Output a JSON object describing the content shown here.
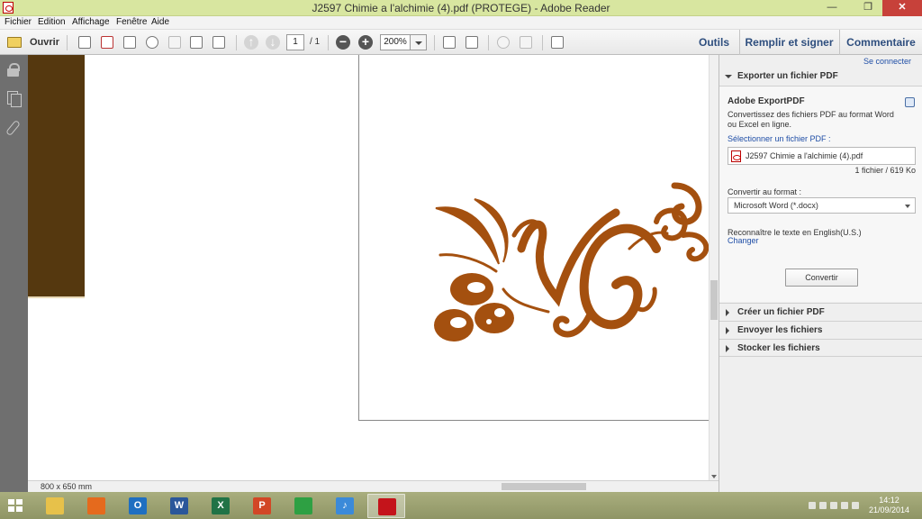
{
  "window": {
    "title": "J2597 Chimie a l'alchimie (4).pdf (PROTEGE) - Adobe Reader",
    "minimize": "—",
    "restore": "❐",
    "close": "✕"
  },
  "menu": [
    "Fichier",
    "Edition",
    "Affichage",
    "Fenêtre",
    "Aide"
  ],
  "toolbar": {
    "open_label": "Ouvrir",
    "page_current": "1",
    "page_total": "/ 1",
    "zoom_value": "200%",
    "tabs": [
      "Outils",
      "Remplir et signer",
      "Commentaire"
    ]
  },
  "status": {
    "page_size": "800 x 650 mm"
  },
  "pane": {
    "connect": "Se connecter",
    "export_header": "Exporter un fichier PDF",
    "export_title": "Adobe ExportPDF",
    "export_desc": "Convertissez des fichiers PDF au format Word ou Excel en ligne.",
    "select_label": "Sélectionner un fichier PDF :",
    "file_name": "J2597 Chimie a l'alchimie (4).pdf",
    "file_count": "1 fichier / 619 Ko",
    "convert_label": "Convertir au format :",
    "format_value": "Microsoft Word (*.docx)",
    "ocr_text": "Reconnaître le texte en English(U.S.)",
    "change_link": "Changer",
    "convert_button": "Convertir",
    "sections": [
      "Créer un fichier PDF",
      "Envoyer les fichiers",
      "Stocker les fichiers"
    ]
  },
  "taskbar": {
    "time": "14:12",
    "date": "21/09/2014",
    "apps": [
      {
        "name": "file-explorer",
        "glyph": "",
        "color": "#e7c14a"
      },
      {
        "name": "firefox",
        "glyph": "",
        "color": "#e56a1d"
      },
      {
        "name": "outlook",
        "glyph": "O",
        "color": "#1f6fc1"
      },
      {
        "name": "word",
        "glyph": "W",
        "color": "#2b579a"
      },
      {
        "name": "excel",
        "glyph": "X",
        "color": "#217346"
      },
      {
        "name": "powerpoint",
        "glyph": "P",
        "color": "#d24726"
      },
      {
        "name": "store",
        "glyph": "",
        "color": "#2ea043"
      },
      {
        "name": "itunes",
        "glyph": "♪",
        "color": "#3b8ad9"
      },
      {
        "name": "adobe-reader",
        "glyph": "",
        "color": "#c4141b"
      }
    ]
  },
  "colors": {
    "logo": "#a4500f",
    "brown_block": "#55380f",
    "accent_link": "#1f4ea6"
  }
}
